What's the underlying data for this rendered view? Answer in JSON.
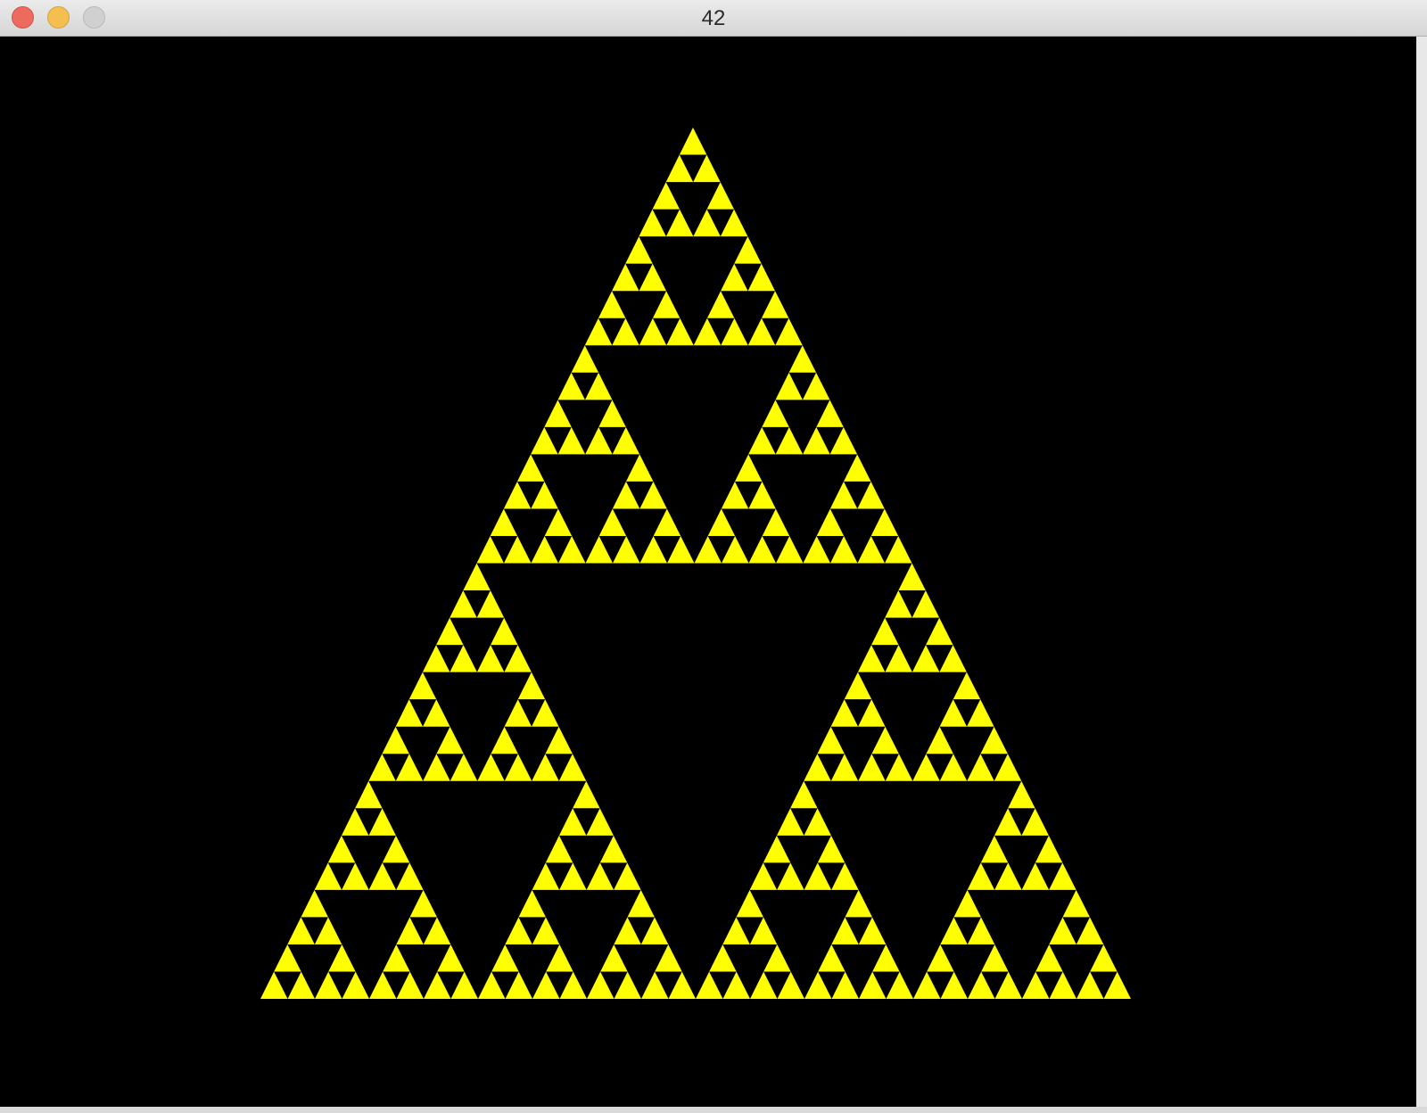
{
  "window": {
    "title": "42"
  },
  "fractal": {
    "shape": "sierpinski-triangle",
    "fill_color": "#ffff00",
    "background_color": "#000000",
    "recursion_depth": 5
  }
}
